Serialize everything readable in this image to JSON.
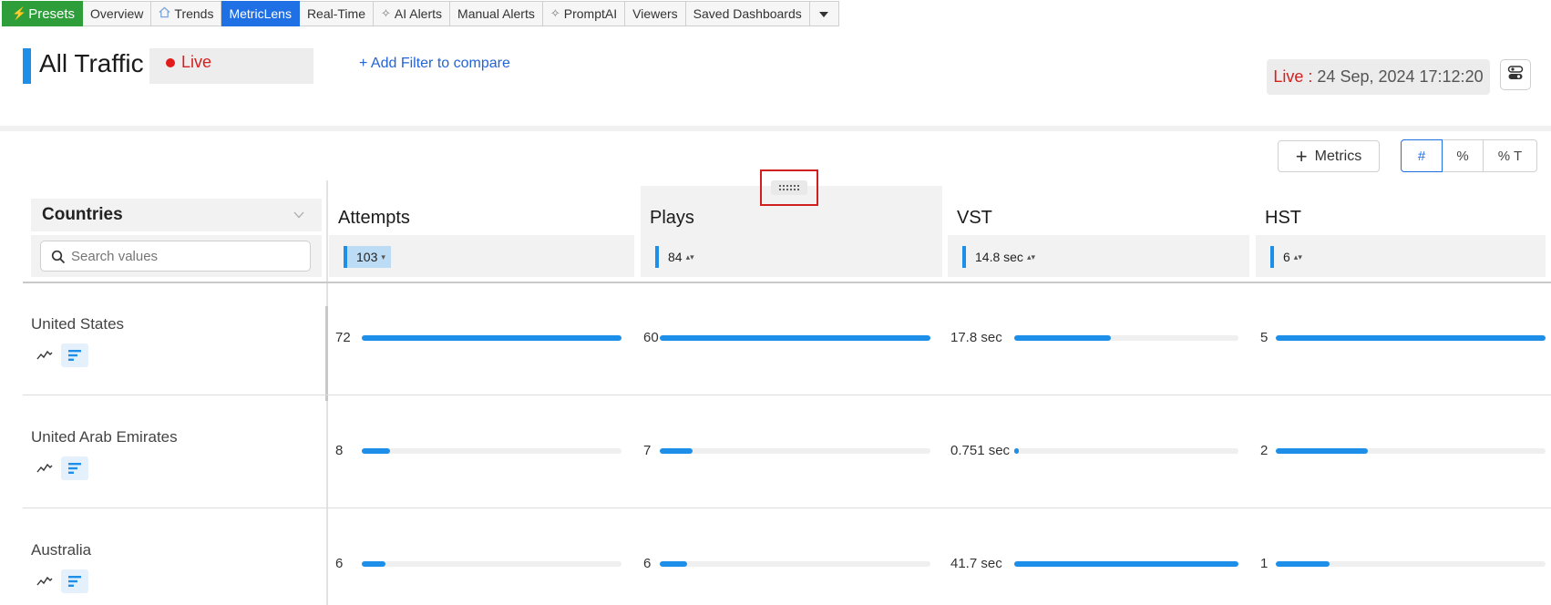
{
  "tabs": [
    {
      "label": "Presets",
      "icon": "bolt-icon"
    },
    {
      "label": "Overview"
    },
    {
      "label": "Trends",
      "icon": "home-icon"
    },
    {
      "label": "MetricLens"
    },
    {
      "label": "Real-Time"
    },
    {
      "label": "AI Alerts",
      "icon": "sparkle-icon"
    },
    {
      "label": "Manual Alerts"
    },
    {
      "label": "PromptAI",
      "icon": "sparkle-icon"
    },
    {
      "label": "Viewers"
    },
    {
      "label": "Saved Dashboards"
    }
  ],
  "active_tab": "MetricLens",
  "header": {
    "title": "All Traffic",
    "live_label": "Live",
    "add_filter": "+ Add Filter to compare",
    "timestamp_live": "Live :",
    "timestamp": "24 Sep, 2024 17:12:20"
  },
  "toolbar": {
    "metrics_label": "Metrics",
    "modes": [
      "#",
      "%",
      "% T"
    ],
    "selected_mode": "#"
  },
  "dimension": {
    "title": "Countries",
    "search_placeholder": "Search values"
  },
  "columns": [
    {
      "name": "Attempts",
      "total": "103",
      "sort": "▾"
    },
    {
      "name": "Plays",
      "total": "84",
      "sort": "▴▾"
    },
    {
      "name": "VST",
      "total": "14.8 sec",
      "sort": "▴▾"
    },
    {
      "name": "HST",
      "total": "6",
      "sort": "▴▾"
    }
  ],
  "rows": [
    {
      "label": "United States",
      "cells": [
        {
          "text": "72",
          "fraction": 1.0
        },
        {
          "text": "60",
          "fraction": 1.0
        },
        {
          "text": "17.8 sec",
          "fraction": 0.43
        },
        {
          "text": "5",
          "fraction": 1.0
        }
      ]
    },
    {
      "label": "United Arab Emirates",
      "cells": [
        {
          "text": "8",
          "fraction": 0.11
        },
        {
          "text": "7",
          "fraction": 0.12
        },
        {
          "text": "0.751 sec",
          "fraction": 0.02
        },
        {
          "text": "2",
          "fraction": 0.34
        }
      ]
    },
    {
      "label": "Australia",
      "cells": [
        {
          "text": "6",
          "fraction": 0.09
        },
        {
          "text": "6",
          "fraction": 0.1
        },
        {
          "text": "41.7 sec",
          "fraction": 1.0
        },
        {
          "text": "1",
          "fraction": 0.2
        }
      ]
    }
  ],
  "colors": {
    "accent": "#1d8fe8",
    "presets": "#2e9e3b",
    "active_tab": "#1f6fe5",
    "live": "#d61f1f"
  }
}
